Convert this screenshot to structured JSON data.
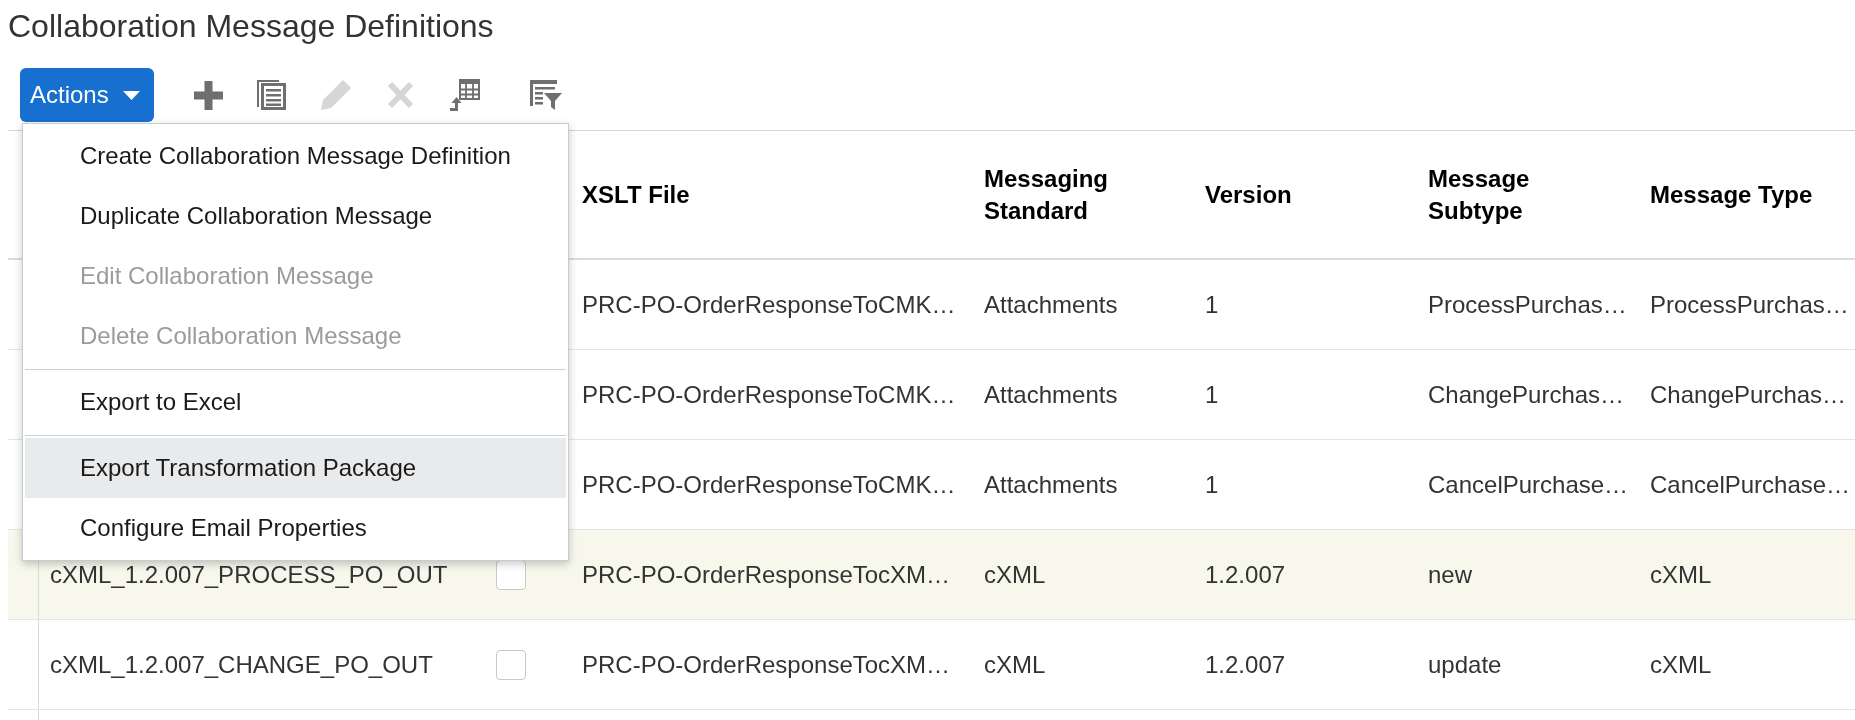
{
  "page": {
    "title": "Collaboration Message Definitions"
  },
  "toolbar": {
    "actions_button": {
      "label": "Actions"
    },
    "tools": [
      {
        "kind": "add",
        "disabled": false
      },
      {
        "kind": "duplicate",
        "disabled": false
      },
      {
        "kind": "edit",
        "disabled": true
      },
      {
        "kind": "delete",
        "disabled": true
      },
      {
        "kind": "export",
        "disabled": false
      },
      {
        "kind": "filter",
        "disabled": false
      }
    ]
  },
  "actions_menu": {
    "sections": [
      [
        {
          "label": "Create Collaboration Message Definition",
          "disabled": false,
          "highlighted": false
        },
        {
          "label": "Duplicate Collaboration Message",
          "disabled": false,
          "highlighted": false
        },
        {
          "label": "Edit Collaboration Message",
          "disabled": true,
          "highlighted": false
        },
        {
          "label": "Delete Collaboration Message",
          "disabled": true,
          "highlighted": false
        }
      ],
      [
        {
          "label": "Export to Excel",
          "disabled": false,
          "highlighted": false
        }
      ],
      [
        {
          "label": "Export Transformation Package",
          "disabled": false,
          "highlighted": true
        },
        {
          "label": "Configure Email Properties",
          "disabled": false,
          "highlighted": false
        }
      ]
    ]
  },
  "table": {
    "columns": [
      "XSLT File",
      "Messaging Standard",
      "Version",
      "Message Subtype",
      "Message Type"
    ],
    "rows": [
      {
        "highlighted": false,
        "cells": [
          "PRC-PO-OrderResponseToCMK…",
          "Attachments",
          "1",
          "ProcessPurchas…",
          "ProcessPurchas…"
        ]
      },
      {
        "highlighted": false,
        "cells": [
          "PRC-PO-OrderResponseToCMK…",
          "Attachments",
          "1",
          "ChangePurchas…",
          "ChangePurchas…"
        ]
      },
      {
        "highlighted": false,
        "cells": [
          "PRC-PO-OrderResponseToCMK…",
          "Attachments",
          "1",
          "CancelPurchase…",
          "CancelPurchase…"
        ]
      },
      {
        "highlighted": true,
        "column_1": "cXML_1.2.007_PROCESS_PO_OUT",
        "column_2": {
          "checked": false
        },
        "cells": [
          "PRC-PO-OrderResponseTocXM…",
          "cXML",
          "1.2.007",
          "new",
          "cXML"
        ]
      },
      {
        "highlighted": false,
        "column_1": "cXML_1.2.007_CHANGE_PO_OUT",
        "column_2": {
          "checked": false
        },
        "cells": [
          "PRC-PO-OrderResponseTocXM…",
          "cXML",
          "1.2.007",
          "update",
          "cXML"
        ]
      }
    ]
  }
}
